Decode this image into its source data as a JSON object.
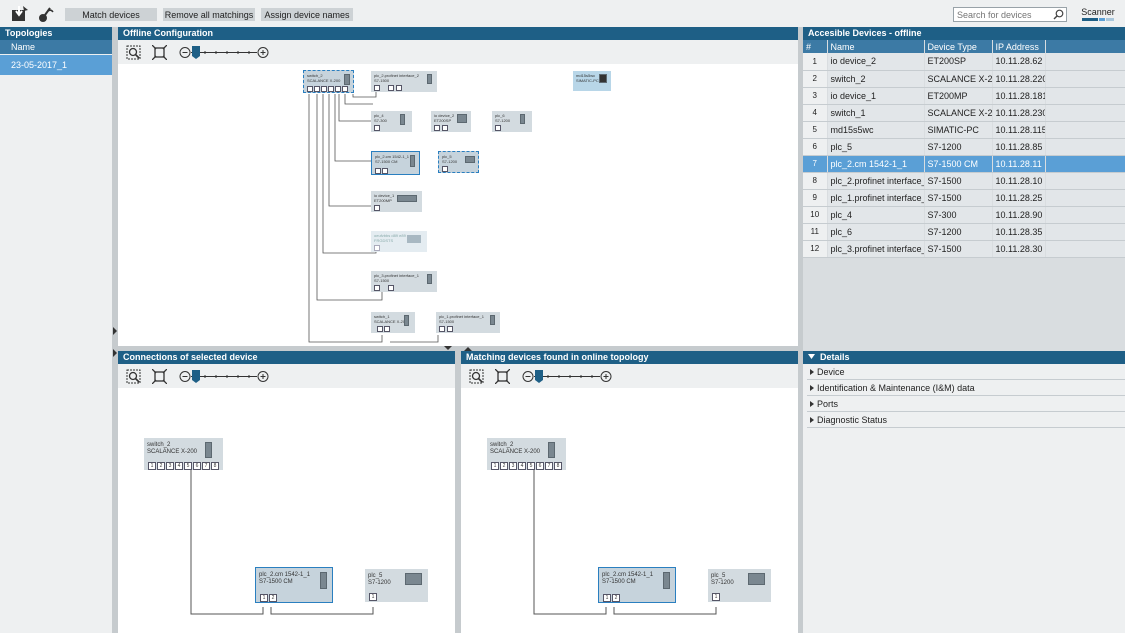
{
  "toolbar": {
    "match_devices": "Match devices",
    "remove_all": "Remove all matchings",
    "assign_names": "Assign device names",
    "search_placeholder": "Search for devices",
    "scanner_label": "Scanner"
  },
  "topologies": {
    "title": "Topologies",
    "col_name": "Name",
    "items": [
      "23-05-2017_1"
    ]
  },
  "offline": {
    "title": "Offline Configuration",
    "nodes": {
      "switch2": {
        "name": "switch_2",
        "type": "SCALANCE X-200"
      },
      "plc2pi2": {
        "name": "plc_2.profinet interface_2",
        "type": "S7-1500"
      },
      "md15": {
        "name": "md15s5wc",
        "type": "SIMATIC-PC"
      },
      "plc4": {
        "name": "plc_4",
        "type": "S7-300"
      },
      "io2": {
        "name": "io device_2",
        "type": "ET200SP"
      },
      "plc6": {
        "name": "plc_6",
        "type": "S7-1200"
      },
      "plc2cm": {
        "name": "plc_2.cm 1542-1_1",
        "type": "S7-1500 CM"
      },
      "plc5": {
        "name": "plc_5",
        "type": "S7-1200"
      },
      "io1": {
        "name": "io device_1",
        "type": "ET200MP"
      },
      "faded": {
        "name": "oeufvbbs d89 e89",
        "type": "FRGDSTS"
      },
      "plc3pi1": {
        "name": "plc_3.profinet interface_1",
        "type": "S7-1500"
      },
      "switch1": {
        "name": "switch_1",
        "type": "SCALANCE X-200"
      },
      "plc1pi1": {
        "name": "plc_1.profinet interface_1",
        "type": "S7-1500"
      }
    }
  },
  "connections": {
    "title": "Connections of selected device",
    "switch": {
      "name": "switch_2",
      "type": "SCALANCE X-200",
      "ports": [
        "1",
        "2",
        "3",
        "4",
        "5",
        "6",
        "7",
        "8"
      ]
    },
    "cm": {
      "name": "plc_2.cm 1542-1_1",
      "type": "S7-1500 CM",
      "ports": [
        "1",
        "2"
      ]
    },
    "plc5": {
      "name": "plc_5",
      "type": "S7-1200",
      "ports": [
        "1"
      ]
    }
  },
  "matching": {
    "title": "Matching devices found in online topology",
    "switch": {
      "name": "switch_2",
      "type": "SCALANCE X-200",
      "ports": [
        "1",
        "2",
        "3",
        "4",
        "5",
        "6",
        "7",
        "8"
      ]
    },
    "cm": {
      "name": "plc_2.cm 1542-1_1",
      "type": "S7-1500 CM",
      "ports": [
        "1",
        "2"
      ]
    },
    "plc5": {
      "name": "plc_5",
      "type": "S7-1200",
      "ports": [
        "1"
      ]
    }
  },
  "accessible": {
    "title": "Accesible Devices - offline",
    "columns": [
      "#",
      "Name",
      "Device Type",
      "IP Address"
    ],
    "selected_row": 7,
    "rows": [
      {
        "n": "1",
        "name": "io device_2",
        "type": "ET200SP",
        "ip": "10.11.28.62"
      },
      {
        "n": "2",
        "name": "switch_2",
        "type": "SCALANCE X-200",
        "ip": "10.11.28.220"
      },
      {
        "n": "3",
        "name": "io device_1",
        "type": "ET200MP",
        "ip": "10.11.28.181"
      },
      {
        "n": "4",
        "name": "switch_1",
        "type": "SCALANCE X-200",
        "ip": "10.11.28.230"
      },
      {
        "n": "5",
        "name": "md15s5wc",
        "type": "SIMATIC-PC",
        "ip": "10.11.28.115"
      },
      {
        "n": "6",
        "name": "plc_5",
        "type": "S7-1200",
        "ip": "10.11.28.85"
      },
      {
        "n": "7",
        "name": "plc_2.cm 1542-1_1",
        "type": "S7-1500 CM",
        "ip": "10.11.28.11"
      },
      {
        "n": "8",
        "name": "plc_2.profinet interface_2",
        "type": "S7-1500",
        "ip": "10.11.28.10"
      },
      {
        "n": "9",
        "name": "plc_1.profinet interface_1",
        "type": "S7-1500",
        "ip": "10.11.28.25"
      },
      {
        "n": "10",
        "name": "plc_4",
        "type": "S7-300",
        "ip": "10.11.28.90"
      },
      {
        "n": "11",
        "name": "plc_6",
        "type": "S7-1200",
        "ip": "10.11.28.35"
      },
      {
        "n": "12",
        "name": "plc_3.profinet interface_1",
        "type": "S7-1500",
        "ip": "10.11.28.30"
      }
    ]
  },
  "details": {
    "title": "Details",
    "items": [
      "Device",
      "Identification & Maintenance (I&M) data",
      "Ports",
      "Diagnostic Status"
    ]
  },
  "colors": {
    "accent": "#1e5f86",
    "selection": "#5a9fd6"
  }
}
